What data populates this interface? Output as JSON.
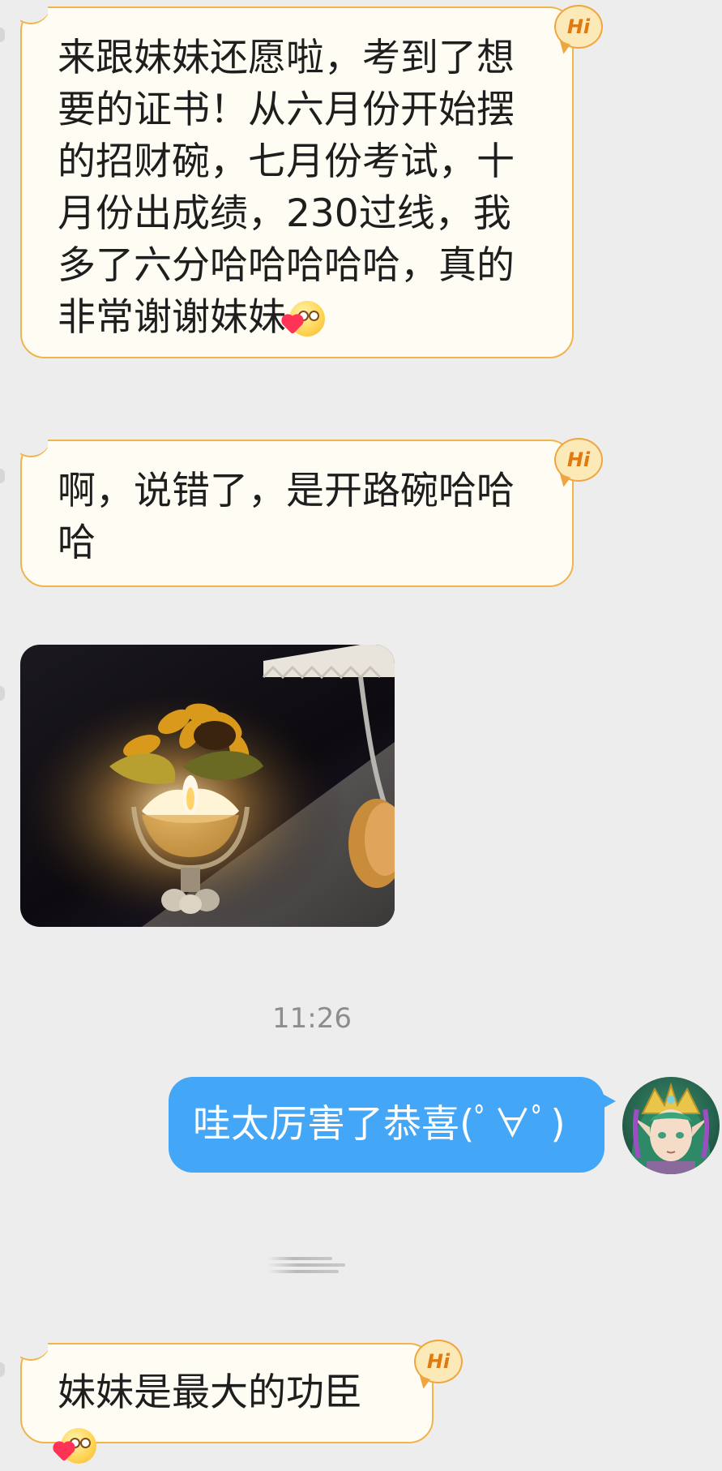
{
  "chat": {
    "messages": [
      {
        "side": "incoming",
        "kind": "text",
        "text": "来跟妹妹还愿啦，考到了想要的证书！从六月份开始摆的招财碗，七月份考试，十月份出成绩，230过线，我多了六分哈哈哈哈哈，真的非常谢谢妹妹",
        "emoji": "shy-heart-emoji",
        "badge": "Hi"
      },
      {
        "side": "incoming",
        "kind": "text",
        "text": "啊，说错了，是开路碗哈哈哈",
        "badge": "Hi"
      },
      {
        "side": "incoming",
        "kind": "image",
        "description_icon": "candle-sunflower-photo"
      },
      {
        "side": "outgoing",
        "kind": "text",
        "text": "哇太厉害了恭喜(ﾟ∀ﾟ)",
        "avatar_icon": "green-haired-elf-avatar"
      },
      {
        "side": "incoming",
        "kind": "text",
        "text": "妹妹是最大的功臣",
        "emoji": "shy-heart-emoji",
        "badge": "Hi"
      }
    ],
    "timestamp": "11:26"
  },
  "colors": {
    "background": "#ededed",
    "incoming_bubble": "#fffdf3",
    "incoming_border": "#f0b44a",
    "outgoing_bubble": "#43a6f6",
    "badge_text": "#e07a10",
    "timestamp_text": "#8d8d8d"
  }
}
